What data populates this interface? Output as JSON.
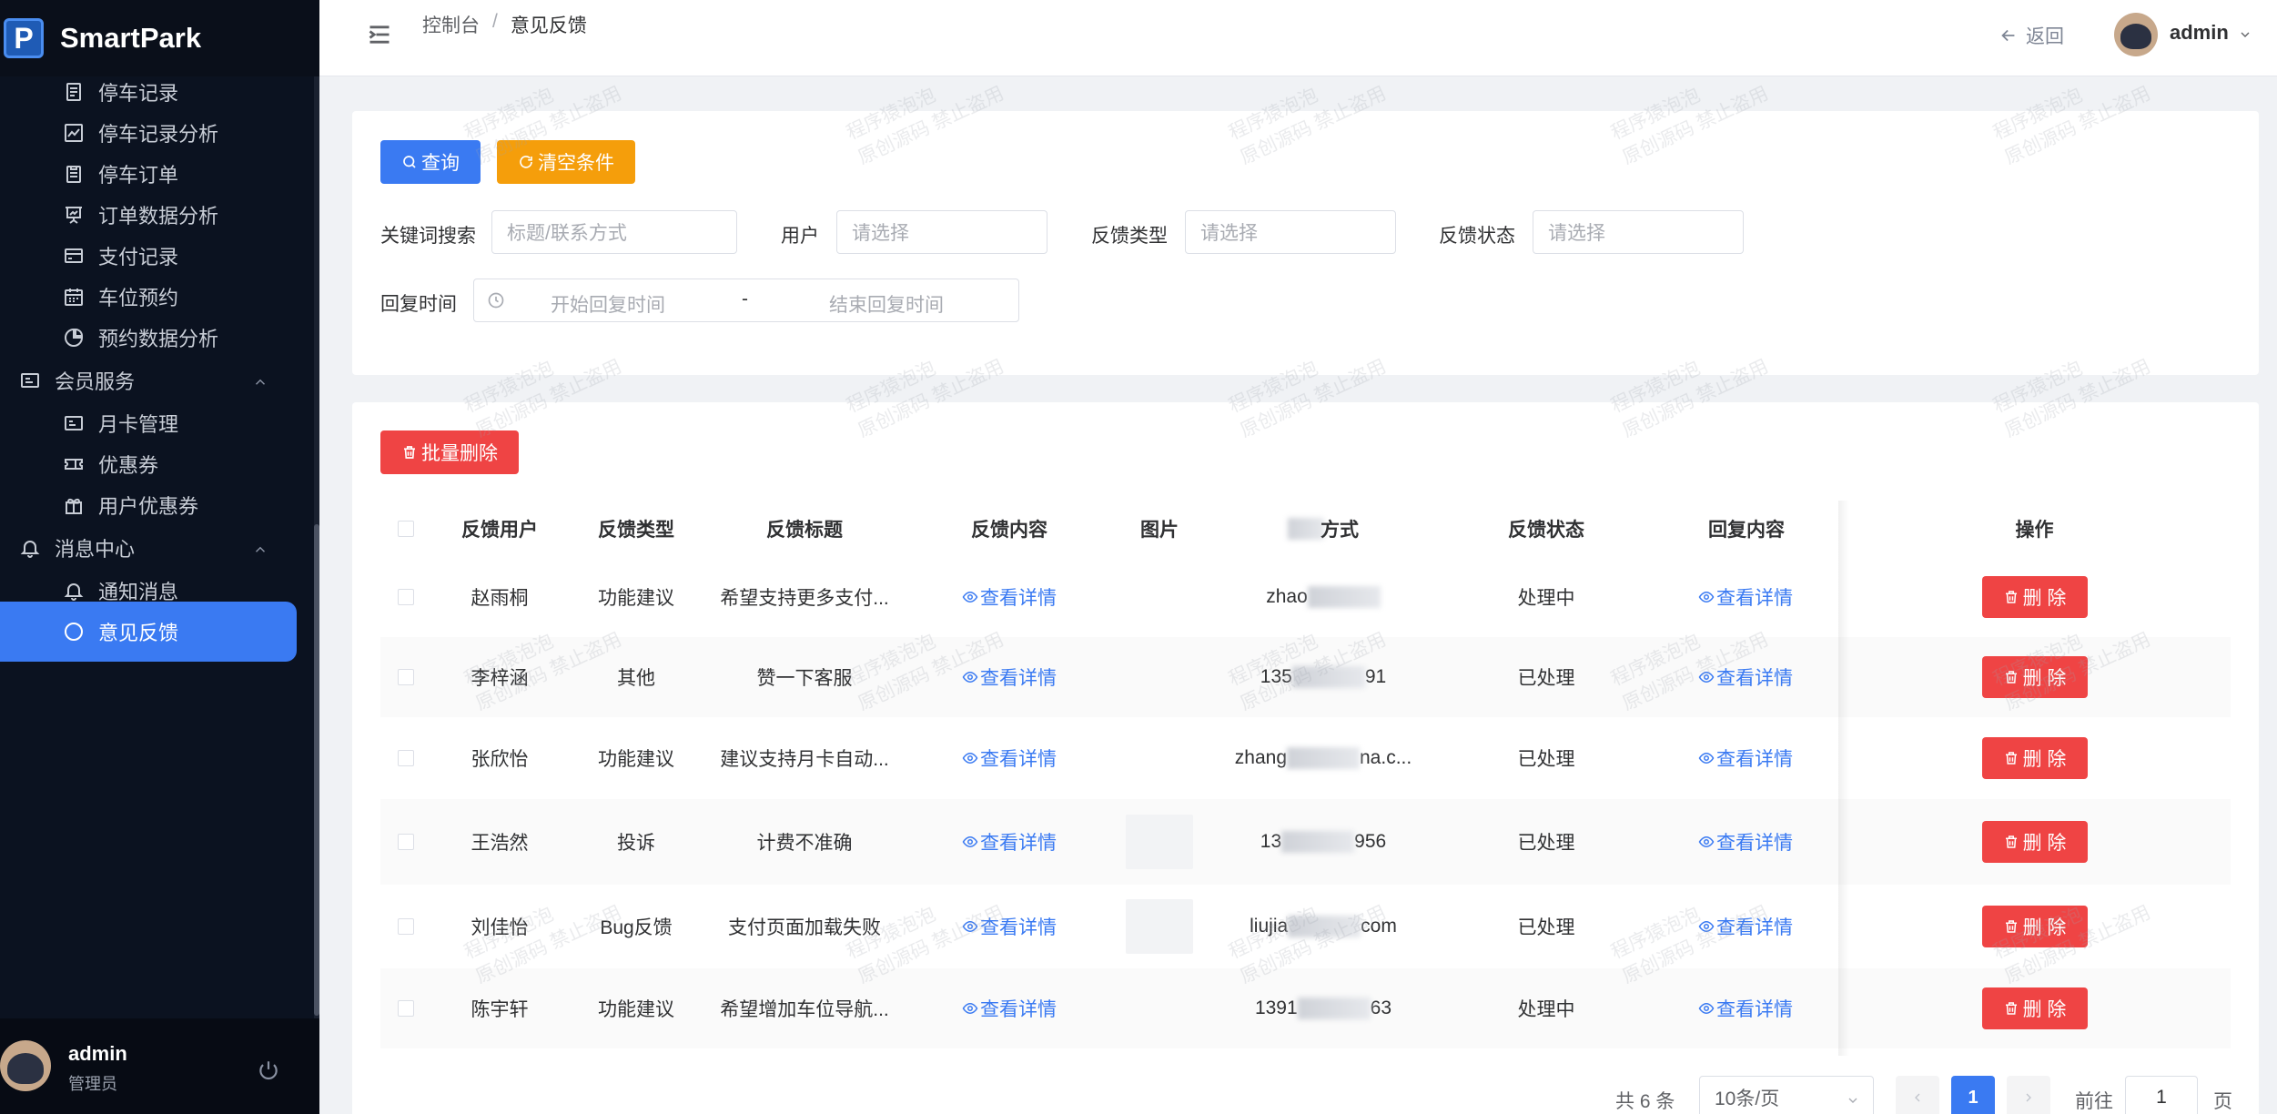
{
  "app": {
    "title": "SmartPark",
    "logo_letter": "P"
  },
  "sidebar": {
    "items": [
      {
        "label": "停车记录",
        "icon": "document-icon",
        "type": "sub"
      },
      {
        "label": "停车记录分析",
        "icon": "chart-icon",
        "type": "sub"
      },
      {
        "label": "停车订单",
        "icon": "clipboard-icon",
        "type": "sub"
      },
      {
        "label": "订单数据分析",
        "icon": "presentation-chart-icon",
        "type": "sub"
      },
      {
        "label": "支付记录",
        "icon": "credit-card-icon",
        "type": "sub"
      },
      {
        "label": "车位预约",
        "icon": "calendar-icon",
        "type": "sub"
      },
      {
        "label": "预约数据分析",
        "icon": "pie-chart-icon",
        "type": "sub"
      },
      {
        "label": "会员服务",
        "icon": "id-card-icon",
        "type": "group"
      },
      {
        "label": "月卡管理",
        "icon": "card-icon",
        "type": "sub"
      },
      {
        "label": "优惠券",
        "icon": "ticket-icon",
        "type": "sub"
      },
      {
        "label": "用户优惠券",
        "icon": "gift-icon",
        "type": "sub"
      },
      {
        "label": "消息中心",
        "icon": "bell-icon",
        "type": "group"
      },
      {
        "label": "通知消息",
        "icon": "bell-icon",
        "type": "sub"
      },
      {
        "label": "意见反馈",
        "icon": "chat-icon",
        "type": "sub",
        "active": true
      }
    ],
    "user": {
      "name": "admin",
      "role": "管理员"
    }
  },
  "header": {
    "breadcrumb": [
      "控制台",
      "意见反馈"
    ],
    "separator": "/",
    "back_label": "返回",
    "user_name": "admin"
  },
  "search": {
    "query_label": "查询",
    "clear_label": "清空条件",
    "keyword_label": "关键词搜索",
    "keyword_placeholder": "标题/联系方式",
    "user_label": "用户",
    "user_placeholder": "请选择",
    "type_label": "反馈类型",
    "type_placeholder": "请选择",
    "status_label": "反馈状态",
    "status_placeholder": "请选择",
    "reply_time_label": "回复时间",
    "start_placeholder": "开始回复时间",
    "range_sep": "-",
    "end_placeholder": "结束回复时间"
  },
  "table": {
    "batch_delete_label": "批量删除",
    "headers": [
      "反馈用户",
      "反馈类型",
      "反馈标题",
      "反馈内容",
      "图片",
      "联系方式",
      "反馈状态",
      "回复内容",
      "操作"
    ],
    "view_label": "查看详情",
    "reply_view_label": "查看详情",
    "delete_label": "删 除",
    "rows": [
      {
        "user": "赵雨桐",
        "type": "功能建议",
        "title": "希望支持更多支付...",
        "has_image": false,
        "contact_prefix": "zhao",
        "contact_suffix": "",
        "status": "处理中"
      },
      {
        "user": "李梓涵",
        "type": "其他",
        "title": "赞一下客服",
        "has_image": false,
        "contact_prefix": "135",
        "contact_suffix": "91",
        "status": "已处理"
      },
      {
        "user": "张欣怡",
        "type": "功能建议",
        "title": "建议支持月卡自动...",
        "has_image": false,
        "contact_prefix": "zhang",
        "contact_suffix": "na.c...",
        "status": "已处理"
      },
      {
        "user": "王浩然",
        "type": "投诉",
        "title": "计费不准确",
        "has_image": true,
        "contact_prefix": "13",
        "contact_suffix": "956",
        "status": "已处理"
      },
      {
        "user": "刘佳怡",
        "type": "Bug反馈",
        "title": "支付页面加载失败",
        "has_image": true,
        "contact_prefix": "liujia",
        "contact_suffix": "com",
        "status": "已处理"
      },
      {
        "user": "陈宇轩",
        "type": "功能建议",
        "title": "希望增加车位导航...",
        "has_image": false,
        "contact_prefix": "1391",
        "contact_suffix": "63",
        "status": "处理中"
      }
    ]
  },
  "pagination": {
    "total_text": "共 6 条",
    "page_size": "10条/页",
    "current_page": "1",
    "goto_label": "前往",
    "goto_value": "1",
    "page_unit": "页"
  },
  "watermark": {
    "line1": "程序猿泡泡",
    "line2": "原创源码 禁止盗用"
  },
  "colors": {
    "primary": "#3a7af2",
    "warning": "#f59e0b",
    "danger": "#ef4444",
    "sidebar_bg": "#0b1220"
  }
}
